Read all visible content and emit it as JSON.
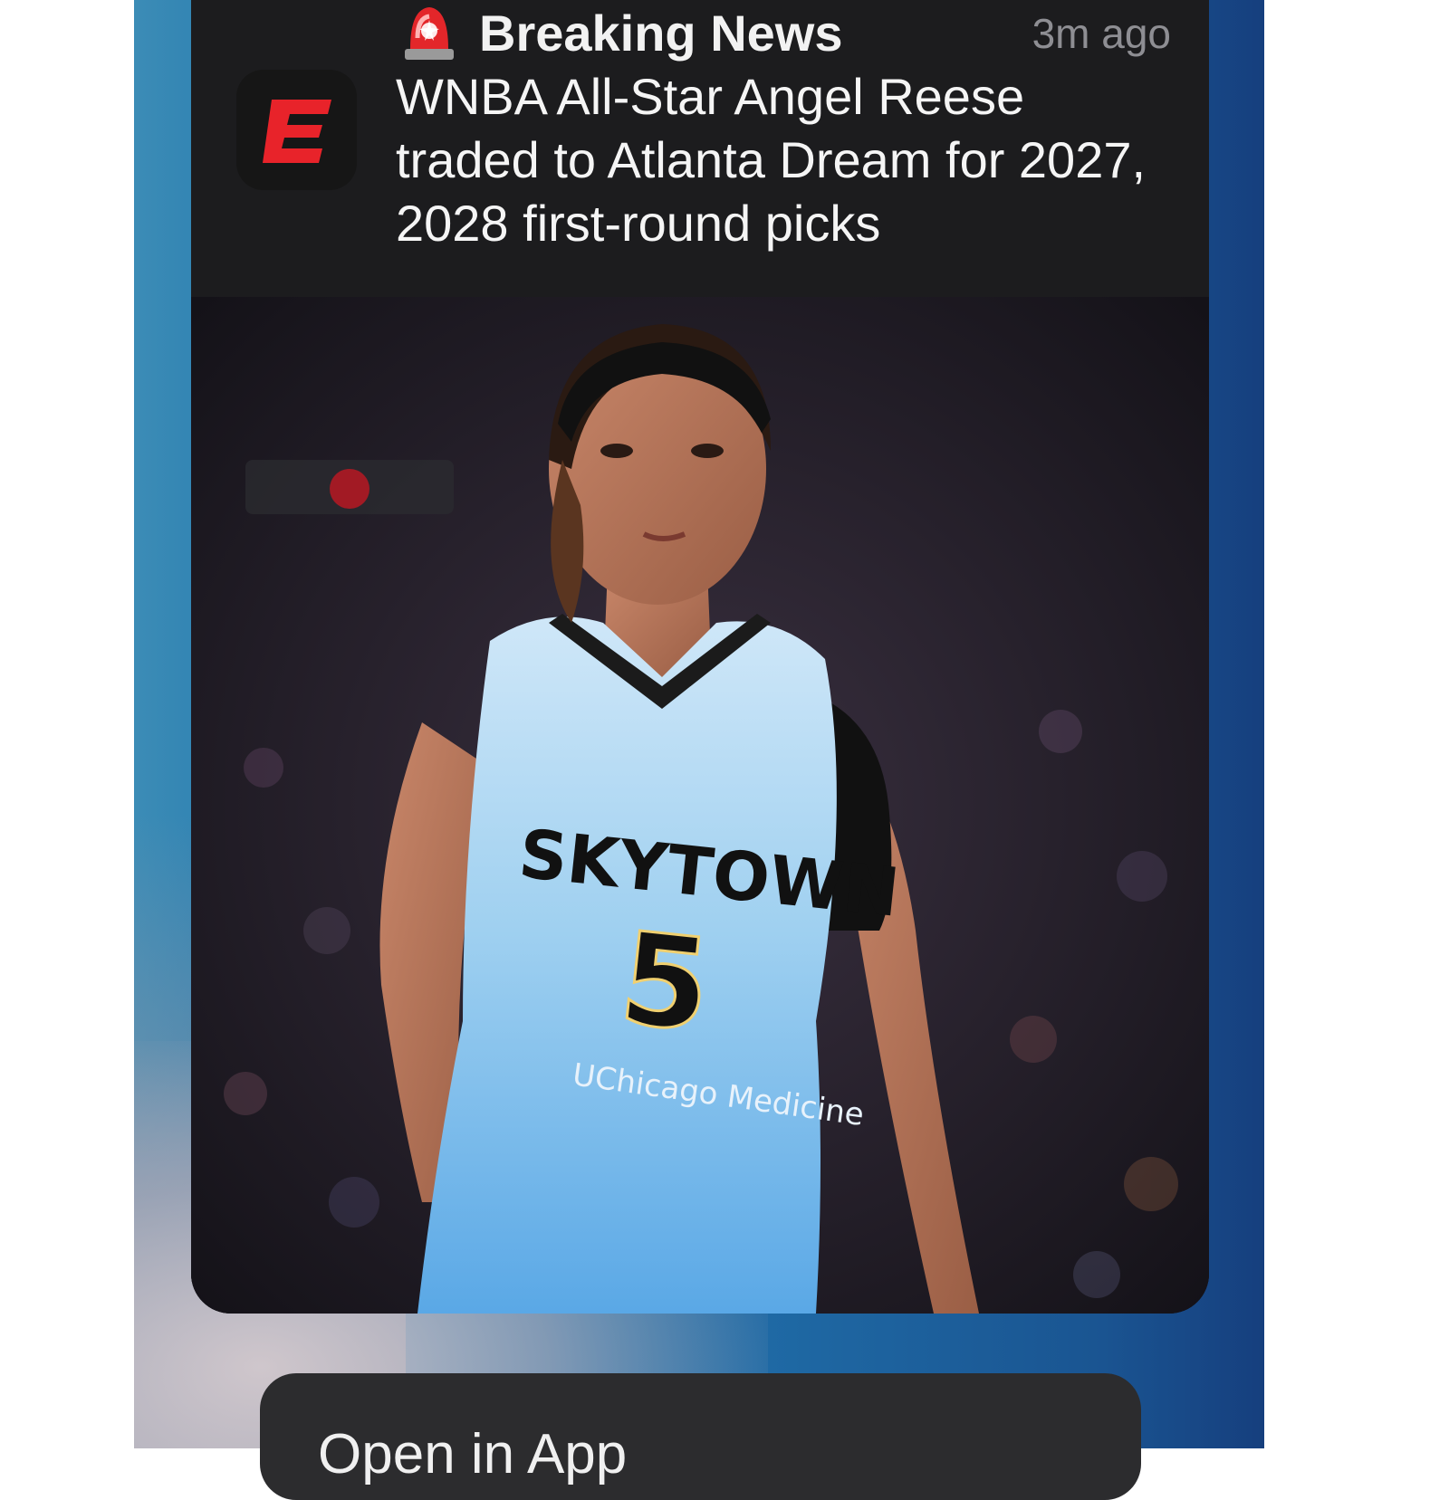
{
  "notification": {
    "category": "Breaking News",
    "timestamp": "3m ago",
    "headline": "WNBA All-Star Angel Reese traded to Atlanta Dream for 2027, 2028 first-round picks",
    "app_icon": "espn-e-logo-icon",
    "badge_icon": "siren-icon",
    "image": {
      "description_icon": "basketball-player-photo",
      "jersey_text": "SKYTOWN",
      "jersey_number": "5",
      "sponsor_text": "UChicago Medicine"
    }
  },
  "actions": {
    "open_label": "Open in App"
  },
  "colors": {
    "accent_red": "#e8232a",
    "card_background": "#1c1c1e",
    "jersey_blue": "#8cc4ec"
  }
}
